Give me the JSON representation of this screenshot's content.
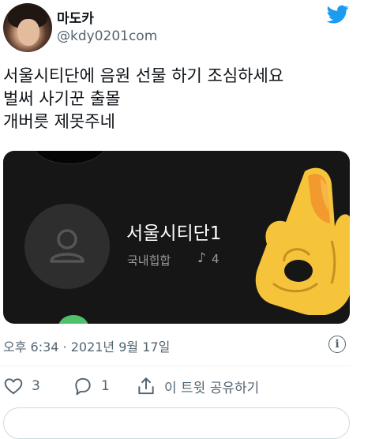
{
  "author": {
    "name": "마도카",
    "handle": "@kdy0201com"
  },
  "tweet": {
    "lines": [
      "서울시티단에 음원 선물 하기 조심하세요",
      "벌써 사기꾼 출몰",
      "개버릇 제못주네"
    ]
  },
  "media": {
    "title": "서울시티단1",
    "genre": "국내힙합",
    "count": "4",
    "icons": [
      "user-icon",
      "music-note-icon",
      "ok-hand-emoji"
    ]
  },
  "meta": {
    "timestamp": "오후 6:34 · 2021년 9월 17일"
  },
  "actions": {
    "like_count": "3",
    "reply_count": "1",
    "share_label": "이 트윗 공유하기"
  },
  "colors": {
    "brand": "#1d9bf0",
    "text_secondary": "#536471",
    "media_bg": "#161616"
  }
}
